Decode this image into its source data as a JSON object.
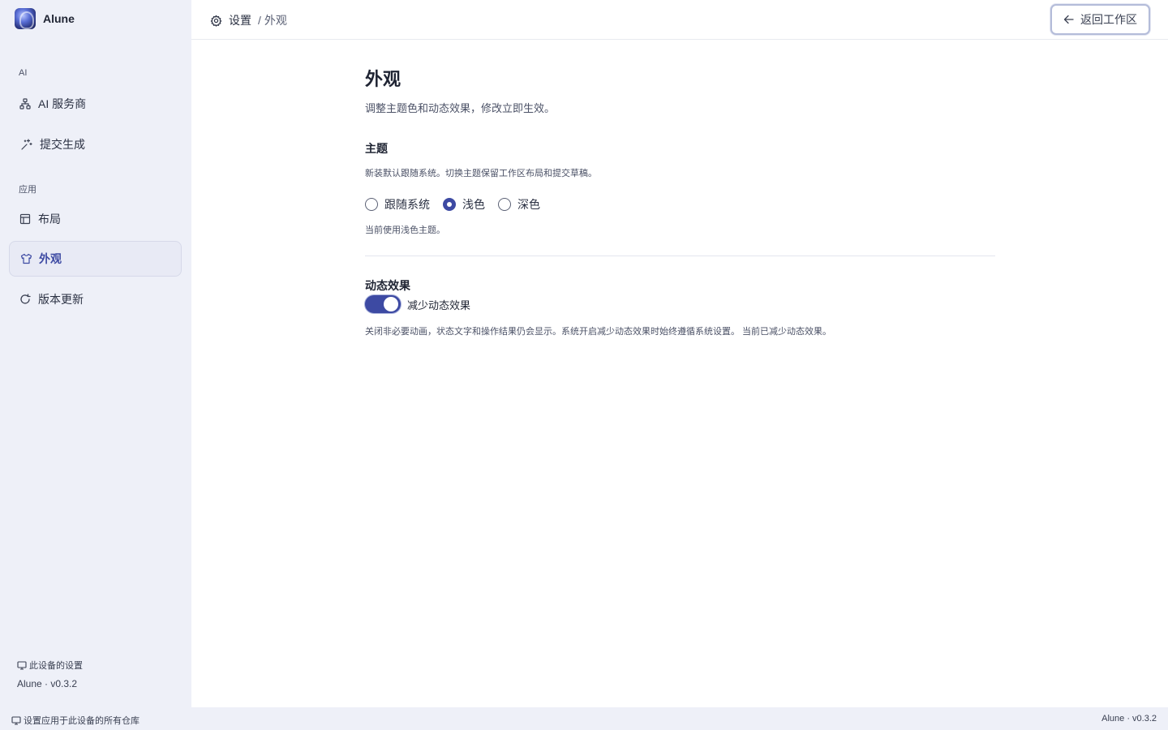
{
  "app": {
    "name": "Alune",
    "logo_icon": "alune-logo-icon"
  },
  "sidebar": {
    "sections": [
      {
        "label": "AI",
        "items": [
          {
            "label": "AI 服务商",
            "icon": "network-icon",
            "active": false
          },
          {
            "label": "提交生成",
            "icon": "sparkle-icon",
            "active": false
          }
        ]
      },
      {
        "label": "应用",
        "items": [
          {
            "label": "布局",
            "icon": "layout-icon",
            "active": false
          },
          {
            "label": "外观",
            "icon": "shirt-icon",
            "active": true
          },
          {
            "label": "版本更新",
            "icon": "refresh-icon",
            "active": false
          }
        ]
      }
    ],
    "footer_device": "此设备的设置",
    "footer_version": "Alune · v0.3.2"
  },
  "header": {
    "breadcrumb_root": "设置",
    "breadcrumb_separator": "/",
    "breadcrumb_current": "外观",
    "back_button": "返回工作区"
  },
  "main": {
    "title": "外观",
    "description": "调整主题色和动态效果，修改立即生效。",
    "theme": {
      "title": "主题",
      "description": "新装默认跟随系统。切换主题保留工作区布局和提交草稿。",
      "options": [
        {
          "label": "跟随系统",
          "checked": false
        },
        {
          "label": "浅色",
          "checked": true
        },
        {
          "label": "深色",
          "checked": false
        }
      ],
      "note": "当前使用浅色主题。"
    },
    "motion": {
      "title": "动态效果",
      "toggle_label": "减少动态效果",
      "toggle_on": true,
      "note": "关闭非必要动画，状态文字和操作结果仍会显示。系统开启减少动态效果时始终遵循系统设置。 当前已减少动态效果。"
    }
  },
  "statusbar": {
    "left": "设置应用于此设备的所有仓库",
    "right": "Alune · v0.3.2"
  },
  "colors": {
    "accent": "#3d4aa3",
    "sidebar_bg": "#eef0f8",
    "text": "#1f2433"
  }
}
